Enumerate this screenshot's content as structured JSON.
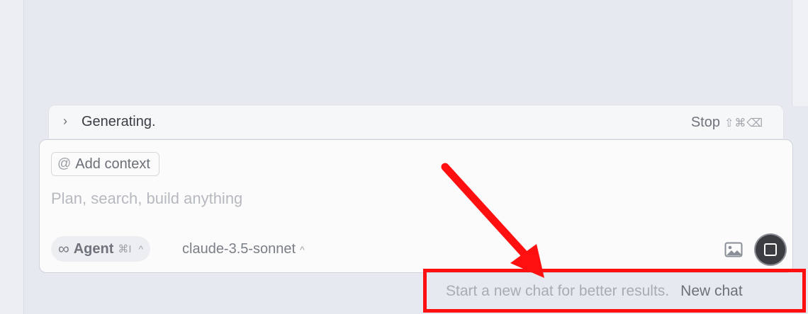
{
  "generating": {
    "label": "Generating.",
    "stop_label": "Stop",
    "stop_shortcut": "⇧⌘⌫"
  },
  "composer": {
    "context_label": "Add context",
    "prompt_placeholder": "Plan, search, build anything",
    "mode_label": "Agent",
    "mode_shortcut": "⌘I",
    "model_label": "claude-3.5-sonnet"
  },
  "hint": {
    "text": "Start a new chat for better results.",
    "new_chat_label": "New chat"
  },
  "icons": [
    "chevron-right-icon",
    "at-icon",
    "infinity-icon",
    "caret-up-icon",
    "image-icon",
    "stop-icon"
  ],
  "colors": {
    "background": "#e6e9f0",
    "annotation_red": "#ff1010",
    "stop_button": "#3b3d42"
  }
}
